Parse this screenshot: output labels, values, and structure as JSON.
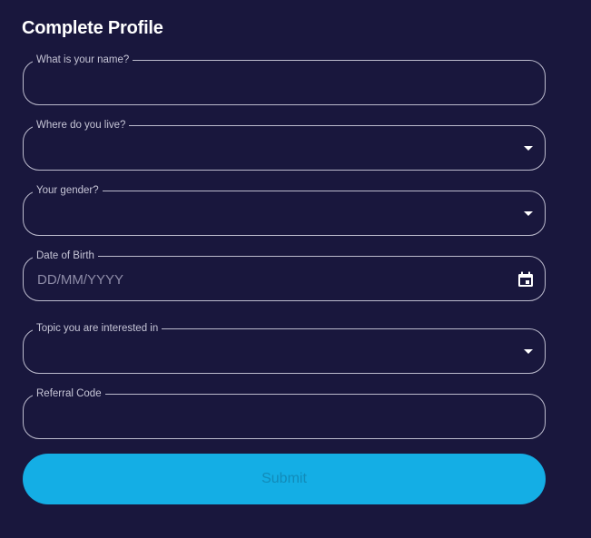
{
  "form": {
    "title": "Complete Profile",
    "fields": [
      {
        "label": "What is your name?",
        "value": "",
        "type": "text"
      },
      {
        "label": "Where do you live?",
        "value": "",
        "type": "select"
      },
      {
        "label": "Your gender?",
        "value": "",
        "type": "select"
      },
      {
        "label": "Date of Birth",
        "placeholder": "DD/MM/YYYY",
        "type": "date"
      },
      {
        "label": "Topic you are interested in",
        "value": "",
        "type": "select"
      },
      {
        "label": "Referral Code",
        "value": "",
        "type": "text"
      }
    ],
    "submit_label": "Submit"
  },
  "colors": {
    "background": "#19173d",
    "border": "#bcbbcd",
    "submit_bg": "#14aee5",
    "submit_text": "#118bb9"
  },
  "icons": {
    "dropdown": "caret-down-icon",
    "date": "calendar-icon"
  }
}
